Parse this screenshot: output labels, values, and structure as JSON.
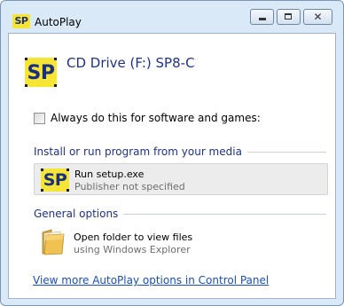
{
  "window": {
    "title": "AutoPlay",
    "logo_text": "SP",
    "buttons": {
      "minimize": "minimize-icon",
      "maximize": "maximize-icon",
      "close": "close-icon",
      "close_glyph": "✕"
    }
  },
  "drive": {
    "logo_text": "SP",
    "title": "CD Drive (F:) SP8-C"
  },
  "always_checkbox": {
    "label": "Always do this for software and games:",
    "checked": false
  },
  "sections": [
    {
      "header": "Install or run program from your media",
      "options": [
        {
          "title": "Run setup.exe",
          "subtitle": "Publisher not specified",
          "icon": "sp-logo-icon",
          "icon_text": "SP"
        }
      ]
    },
    {
      "header": "General options",
      "options": [
        {
          "title": "Open folder to view files",
          "subtitle": "using Windows Explorer",
          "icon": "folder-icon"
        }
      ]
    }
  ],
  "footer_link": "View more AutoPlay options in Control Panel",
  "colors": {
    "accent_text": "#1e3287",
    "link": "#1a4fb6",
    "logo_yellow": "#f7e536",
    "logo_blue": "#1b2f80",
    "frame": "#d9e9f7",
    "highlight": "#ececec"
  }
}
